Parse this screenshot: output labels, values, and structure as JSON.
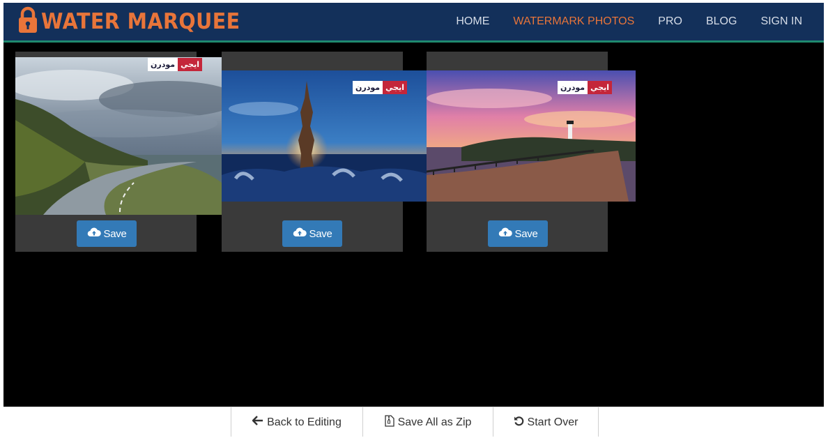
{
  "brand": {
    "title": "WATER MARQUEE",
    "icon": "lock-icon",
    "color": "#e8753a"
  },
  "nav": {
    "items": [
      {
        "label": "HOME",
        "active": false
      },
      {
        "label": "WATERMARK PHOTOS",
        "active": true
      },
      {
        "label": "PRO",
        "active": false
      },
      {
        "label": "BLOG",
        "active": false
      },
      {
        "label": "SIGN IN",
        "active": false
      }
    ]
  },
  "watermark": {
    "part1": "ايجي",
    "part2": "مودرن"
  },
  "cards": [
    {
      "save_label": "Save",
      "icon": "cloud-upload-icon"
    },
    {
      "save_label": "Save",
      "icon": "cloud-upload-icon"
    },
    {
      "save_label": "Save",
      "icon": "cloud-upload-icon"
    }
  ],
  "toolbar": {
    "back_label": "Back to Editing",
    "zip_label": "Save All as Zip",
    "start_over_label": "Start Over"
  },
  "colors": {
    "navbar": "#13305a",
    "accent": "#e8753a",
    "button": "#337ab7",
    "card": "#3a3a3a"
  }
}
